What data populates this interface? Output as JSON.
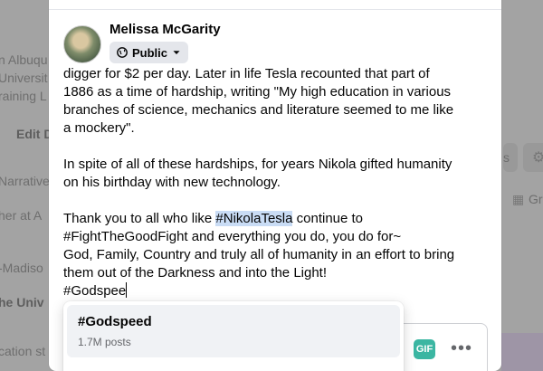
{
  "background": {
    "lines": [
      "n Albuqu",
      "Universit",
      "raining L",
      "Edit D",
      "Narrative",
      "her at A",
      "-Madiso",
      "he Univ",
      "cation st"
    ],
    "right_label_1": "s",
    "right_label_2": "Gr"
  },
  "composer": {
    "user_name": "Melissa McGarity",
    "privacy_label": "Public",
    "text": {
      "line1": "digger for $2 per day. Later in life Tesla recounted that part of",
      "line2": "1886 as a time of hardship, writing \"My high education in various",
      "line3": "branches of science, mechanics and literature seemed to me like",
      "line4": "a mockery\".",
      "line5": "In spite of all of these hardships, for years Nikola gifted humanity",
      "line6": "on his birthday with new technology.",
      "line7_a": "Thank you to all who like ",
      "line7_tag": "#NikolaTesla",
      "line7_b": " continue to",
      "line8": "#FightTheGoodFight and everything you do, you do for~",
      "line9": "God, Family, Country and truly all of humanity in an effort to bring",
      "line10": "them out of the Darkness and into the Light!",
      "line11": "#Godspee"
    },
    "toolbar": {
      "gif_label": "GIF",
      "more_label": "•••"
    }
  },
  "suggestions": [
    {
      "tag": "#Godspeed",
      "count": "1.7M posts"
    }
  ]
}
